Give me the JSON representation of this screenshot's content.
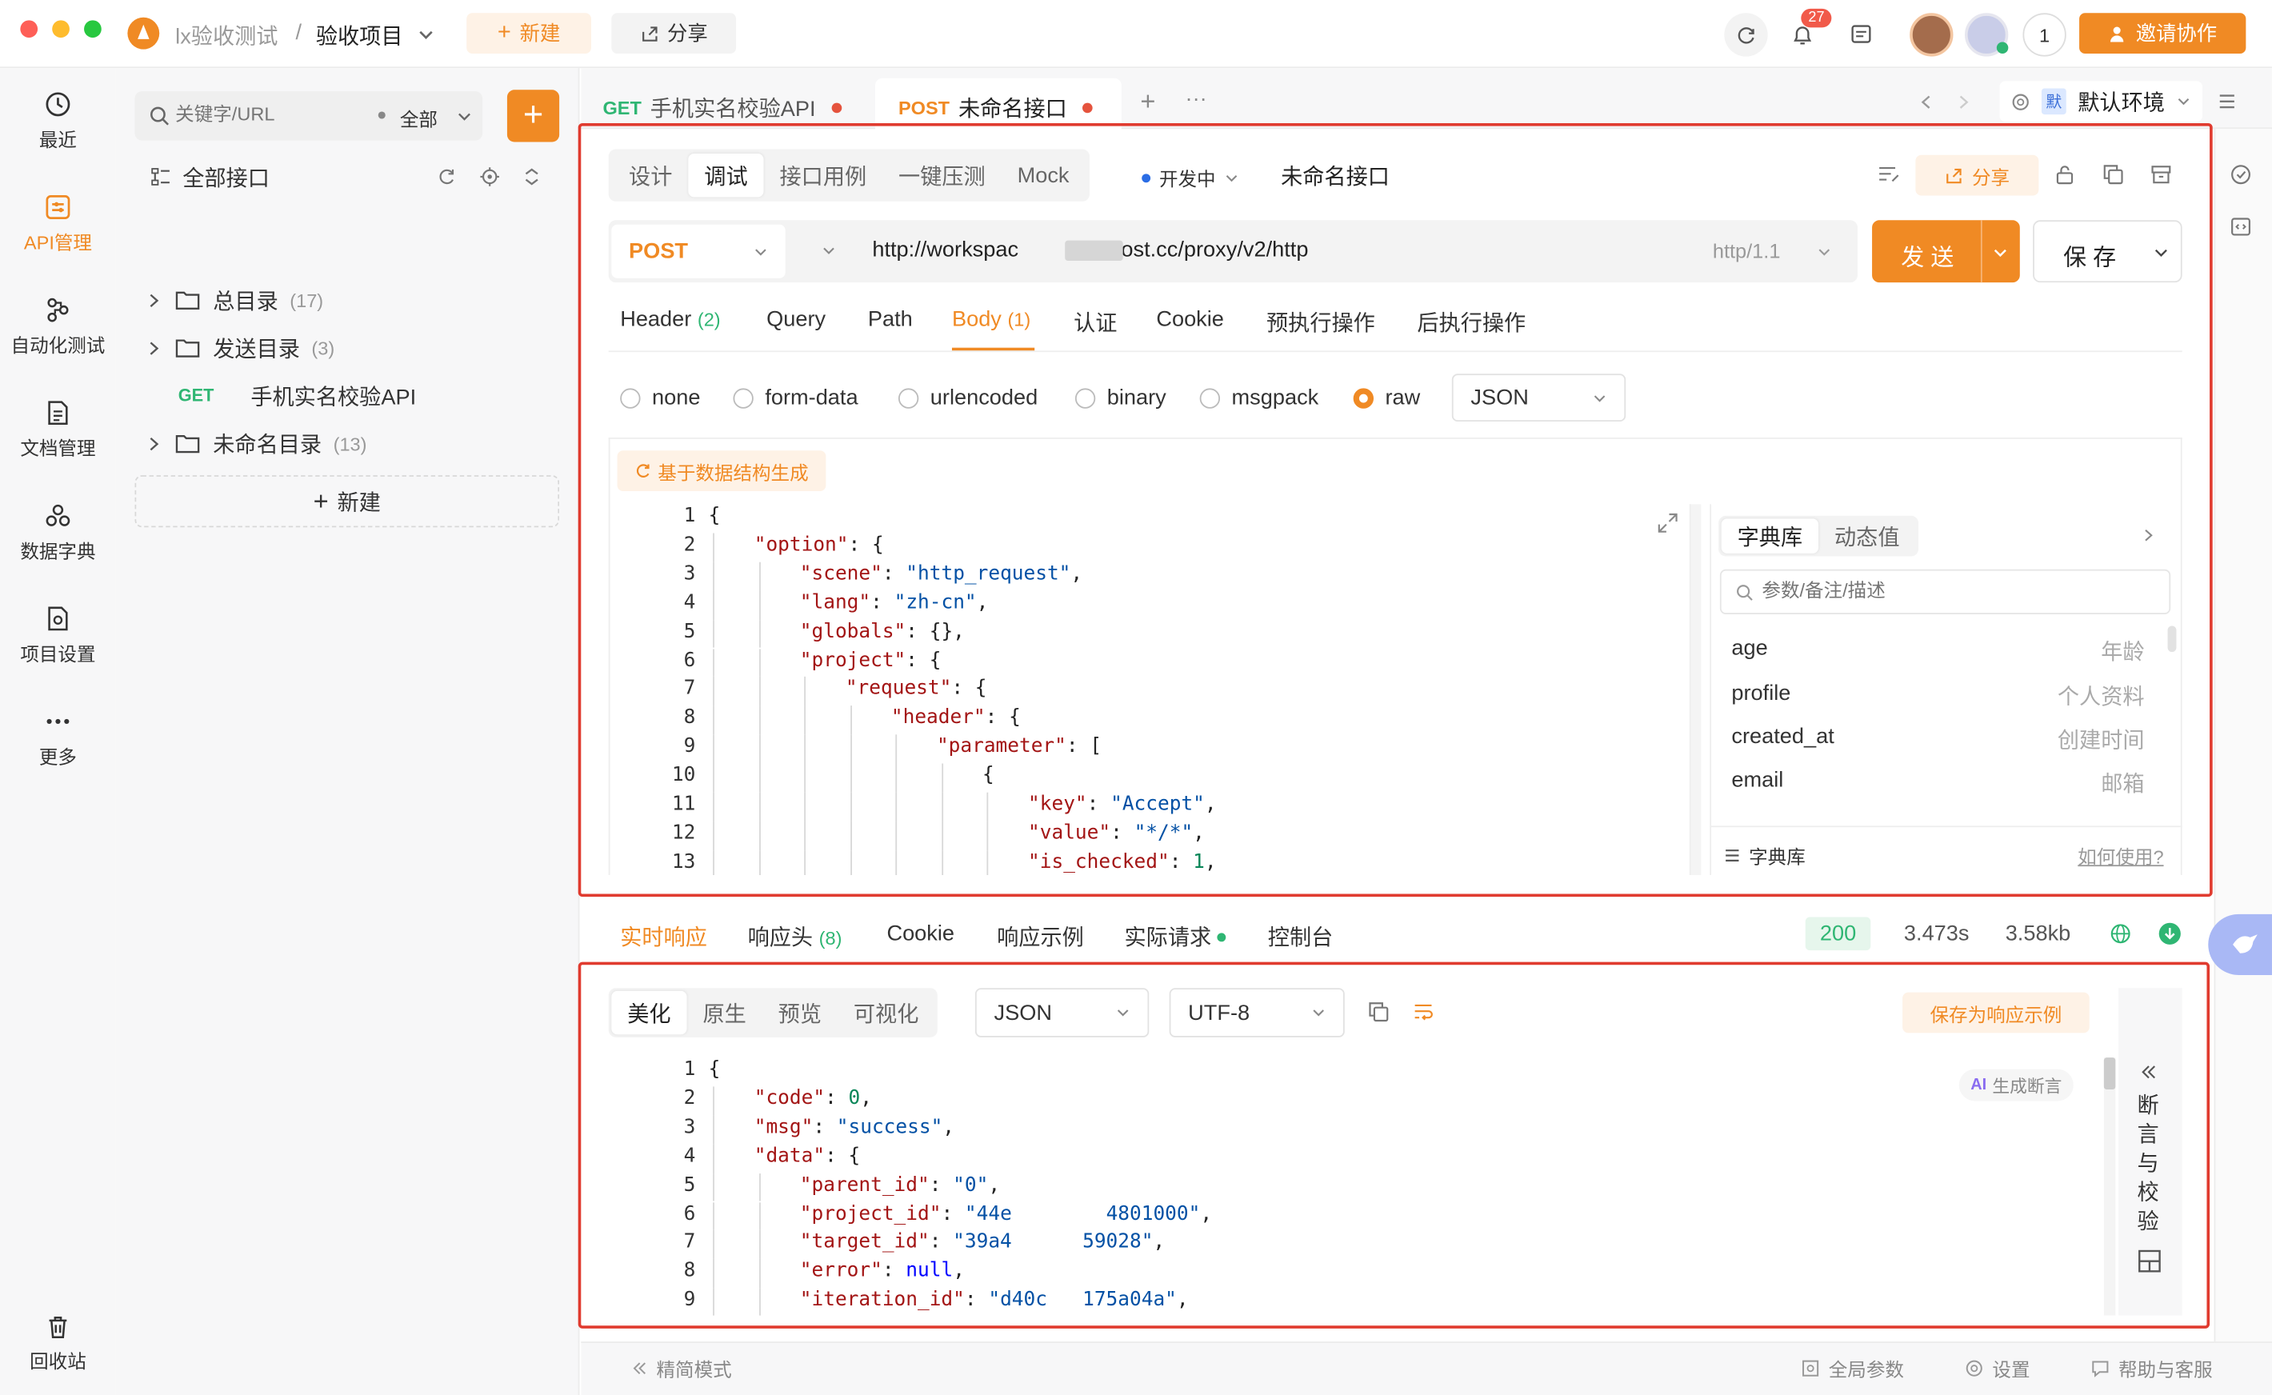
{
  "window": {
    "breadcrumb_team": "lx验收测试",
    "breadcrumb_sep": "/",
    "project": "验收项目",
    "new_label": "新建",
    "share_label": "分享",
    "notif_count": "27",
    "member_count": "1",
    "invite_label": "邀请协作"
  },
  "nav": {
    "items": [
      {
        "label": "最近"
      },
      {
        "label": "API管理"
      },
      {
        "label": "自动化测试"
      },
      {
        "label": "文档管理"
      },
      {
        "label": "数据字典"
      },
      {
        "label": "项目设置"
      },
      {
        "label": "更多"
      }
    ],
    "trash": "回收站"
  },
  "tree": {
    "search_placeholder": "关键字/URL",
    "filter": "全部",
    "root": "全部接口",
    "folders": [
      {
        "name": "总目录",
        "count": "(17)"
      },
      {
        "name": "发送目录",
        "count": "(3)"
      },
      {
        "name": "未命名目录",
        "count": "(13)"
      }
    ],
    "api_item": {
      "method": "GET",
      "name": "手机实名校验API"
    },
    "new_label": "新建"
  },
  "tabs": [
    {
      "method": "GET",
      "name": "手机实名校验API"
    },
    {
      "method": "POST",
      "name": "未命名接口"
    }
  ],
  "env": {
    "badge": "默",
    "name": "默认环境"
  },
  "request": {
    "modes": [
      "设计",
      "调试",
      "接口用例",
      "一键压测",
      "Mock"
    ],
    "status": "开发中",
    "name": "未命名接口",
    "share": "分享",
    "method": "POST",
    "url": "http://workspac              .post.cc/proxy/v2/http",
    "protocol": "http/1.1",
    "send": "发 送",
    "save": "保 存",
    "subtabs": {
      "header": "Header",
      "header_count": "(2)",
      "query": "Query",
      "path": "Path",
      "body": "Body",
      "body_count": "(1)",
      "auth": "认证",
      "cookie": "Cookie",
      "pre": "预执行操作",
      "post": "后执行操作"
    },
    "body_types": [
      "none",
      "form-data",
      "urlencoded",
      "binary",
      "msgpack",
      "raw"
    ],
    "raw_format": "JSON",
    "generate": "基于数据结构生成"
  },
  "dict": {
    "tabs": [
      "字典库",
      "动态值"
    ],
    "search_placeholder": "参数/备注/描述",
    "rows": [
      {
        "k": "age",
        "v": "年龄"
      },
      {
        "k": "profile",
        "v": "个人资料"
      },
      {
        "k": "created_at",
        "v": "创建时间"
      },
      {
        "k": "email",
        "v": "邮箱"
      }
    ],
    "footer": "字典库",
    "help": "如何使用?"
  },
  "response": {
    "tabs": {
      "live": "实时响应",
      "headers": "响应头",
      "headers_count": "(8)",
      "cookie": "Cookie",
      "example": "响应示例",
      "actual": "实际请求",
      "console": "控制台"
    },
    "status_code": "200",
    "time": "3.473s",
    "size": "3.58kb",
    "view_modes": [
      "美化",
      "原生",
      "预览",
      "可视化"
    ],
    "format": "JSON",
    "encoding": "UTF-8",
    "save_example": "保存为响应示例",
    "ai_assert": "生成断言",
    "assert_panel": "断言与校验"
  },
  "footer": {
    "simple_mode": "精简模式",
    "global_params": "全局参数",
    "settings": "设置",
    "help": "帮助与客服"
  },
  "colors": {
    "accent": "#f08a24",
    "red_box": "#e03b2f",
    "get": "#2fb673",
    "post": "#f08a24"
  }
}
